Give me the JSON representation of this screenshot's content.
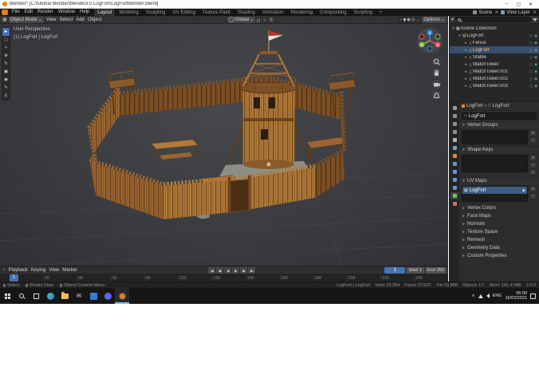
{
  "window": {
    "title": "Blender* [C:\\tutorial blender\\blende\\3.0 LogFort\\LogFortBlender.blend]",
    "minimize": "–",
    "maximize": "▢",
    "close": "✕"
  },
  "topbar": {
    "menus": [
      "File",
      "Edit",
      "Render",
      "Window",
      "Help"
    ],
    "tabs": [
      {
        "label": "Layout",
        "active": true,
        "name": "tab-layout"
      },
      {
        "label": "Modeling",
        "name": "tab-modeling"
      },
      {
        "label": "Sculpting",
        "name": "tab-sculpting"
      },
      {
        "label": "UV Editing",
        "name": "tab-uv-editing"
      },
      {
        "label": "Texture Paint",
        "name": "tab-texture-paint"
      },
      {
        "label": "Shading",
        "name": "tab-shading"
      },
      {
        "label": "Animation",
        "name": "tab-animation"
      },
      {
        "label": "Rendering",
        "name": "tab-rendering"
      },
      {
        "label": "Compositing",
        "name": "tab-compositing"
      },
      {
        "label": "Scripting",
        "name": "tab-scripting"
      },
      {
        "label": "+",
        "name": "add-workspace-button"
      }
    ],
    "scene_label": "Scene",
    "view_layer_label": "View Layer"
  },
  "viewport_header": {
    "mode": "Object Mode",
    "menus": [
      "View",
      "Select",
      "Add",
      "Object"
    ],
    "orientation": "Global",
    "options_label": "Options"
  },
  "icons": {
    "dropdown": "⌄",
    "arrow_right": "▸",
    "arrow_down": "▾",
    "editor_3d": "▦",
    "editor_timeline": "◔",
    "globe": "◯",
    "magnet": "U",
    "proportional": "◎",
    "wire": "○",
    "solid": "●",
    "material": "◉",
    "rendered": "◎",
    "visibility": "▢",
    "render_toggle": "◉",
    "plus": "+",
    "minus": "−",
    "menu_down": "⌄",
    "camera": "◉",
    "uv_grid": "▦",
    "breadcrumb_sep": "›",
    "mesh_data": "▽",
    "close_x": "✕"
  },
  "toolbar": {
    "tools": [
      {
        "glyph": "►",
        "name": "tool-select-tweak",
        "active": true
      },
      {
        "glyph": "▢",
        "name": "tool-select-box"
      },
      {
        "glyph": "+",
        "name": "tool-3d-cursor"
      },
      {
        "glyph": "⊕",
        "name": "tool-move"
      },
      {
        "glyph": "↻",
        "name": "tool-rotate"
      },
      {
        "glyph": "▣",
        "name": "tool-scale"
      },
      {
        "glyph": "◉",
        "name": "tool-transform"
      },
      {
        "glyph": "✎",
        "name": "tool-annotate"
      },
      {
        "glyph": "∠",
        "name": "tool-measure"
      }
    ]
  },
  "viewport": {
    "overlay_line1": "User Perspective",
    "overlay_line2": "(1) LogFort | LogFort",
    "gizmo": {
      "x": "X",
      "y": "Y",
      "z": "Z"
    }
  },
  "outliner": {
    "items": [
      {
        "label": "Scene Collection",
        "level": 0,
        "arrow": "▾",
        "icon": "▦",
        "icon_color": "#d0d0d0",
        "toggles": false,
        "name": "outliner-scene-collection"
      },
      {
        "label": "LogFort",
        "level": 1,
        "arrow": "▾",
        "icon": "▤",
        "icon_color": "#e8b465",
        "name": "outliner-collection-logfort"
      },
      {
        "label": "Fence",
        "level": 2,
        "arrow": "▸",
        "icon": "△",
        "icon_color": "#e8a258",
        "name": "outliner-object-fence"
      },
      {
        "label": "LogFort",
        "level": 2,
        "arrow": "▸",
        "icon": "△",
        "icon_color": "#ffb14d",
        "selected": true,
        "name": "outliner-object-logfort"
      },
      {
        "label": "Stable",
        "level": 2,
        "arrow": "▸",
        "icon": "△",
        "icon_color": "#e8a258",
        "name": "outliner-object-stable"
      },
      {
        "label": "WatchTower",
        "level": 2,
        "arrow": "▸",
        "icon": "△",
        "icon_color": "#e8a258",
        "name": "outliner-object-watchtower"
      },
      {
        "label": "WatchTower.001",
        "level": 2,
        "arrow": "▸",
        "icon": "△",
        "icon_color": "#e8a258",
        "name": "outliner-object-watchtower-001"
      },
      {
        "label": "WatchTower.002",
        "level": 2,
        "arrow": "▸",
        "icon": "△",
        "icon_color": "#e8a258",
        "name": "outliner-object-watchtower-002"
      },
      {
        "label": "WatchTower.003",
        "level": 2,
        "arrow": "▸",
        "icon": "△",
        "icon_color": "#e8a258",
        "name": "outliner-object-watchtower-003"
      }
    ]
  },
  "properties": {
    "tabs": [
      {
        "name": "tab-tool-properties",
        "color": "#9a9a9a"
      },
      {
        "name": "tab-render-properties",
        "color": "#8f8f8f"
      },
      {
        "name": "tab-output-properties",
        "color": "#8f8f8f"
      },
      {
        "name": "tab-view-layer-properties",
        "color": "#8f8f8f"
      },
      {
        "name": "tab-scene-properties",
        "color": "#b5b5b5"
      },
      {
        "name": "tab-world-properties",
        "color": "#7f9fbf"
      },
      {
        "name": "tab-object-properties",
        "color": "#e0883a"
      },
      {
        "name": "tab-modifier-properties",
        "color": "#6f8fd0"
      },
      {
        "name": "tab-particle-properties",
        "color": "#6f8fd0"
      },
      {
        "name": "tab-physics-properties",
        "color": "#6f8fd0"
      },
      {
        "name": "tab-constraint-properties",
        "color": "#6f8fd0"
      },
      {
        "name": "tab-object-data-properties",
        "color": "#6fbf5f",
        "active": true
      },
      {
        "name": "tab-material-properties",
        "color": "#cf6f6f"
      }
    ],
    "breadcrumb_object": "LogFort",
    "breadcrumb_data": "LogFort",
    "name_field": "LogFort",
    "vertex_groups_label": "Vertex Groups",
    "shape_keys_label": "Shape Keys",
    "uv_maps_label": "UV Maps",
    "uv_items": [
      {
        "label": "LogFort",
        "selected": true
      }
    ],
    "collapsed_sections": [
      "Vertex Colors",
      "Face Maps",
      "Normals",
      "Texture Space",
      "Remesh",
      "Geometry Data",
      "Custom Properties"
    ]
  },
  "timeline": {
    "menus": [
      "Playback",
      "Keying",
      "View",
      "Marker"
    ],
    "transport": [
      {
        "glyph": "|◀",
        "name": "jump-to-start-button"
      },
      {
        "glyph": "◀•",
        "name": "jump-prev-keyframe-button"
      },
      {
        "glyph": "◀",
        "name": "play-reverse-button"
      },
      {
        "glyph": "▶",
        "name": "play-button"
      },
      {
        "glyph": "•▶",
        "name": "jump-next-keyframe-button"
      },
      {
        "glyph": "▶|",
        "name": "jump-to-end-button"
      }
    ],
    "current_frame": "1",
    "start_label": "Start",
    "start_value": "1",
    "end_label": "End",
    "end_value": "250",
    "ticks": [
      "0",
      "20",
      "40",
      "60",
      "80",
      "100",
      "120",
      "140",
      "160",
      "180",
      "200",
      "220",
      "240"
    ]
  },
  "statusbar": {
    "hints": [
      {
        "label": "Select"
      },
      {
        "label": "Rotate View"
      },
      {
        "label": "Object Context Menu"
      }
    ],
    "stats": [
      "LogFort | LogFort",
      "Verts 29,354",
      "Faces 27,022",
      "Tris 53,898",
      "Objects 1/7",
      "Mem: 181.4 MiB",
      "3.0.0"
    ]
  },
  "taskbar": {
    "tray_lang": "ENG",
    "time": "06:00",
    "date": "16/03/2021"
  }
}
